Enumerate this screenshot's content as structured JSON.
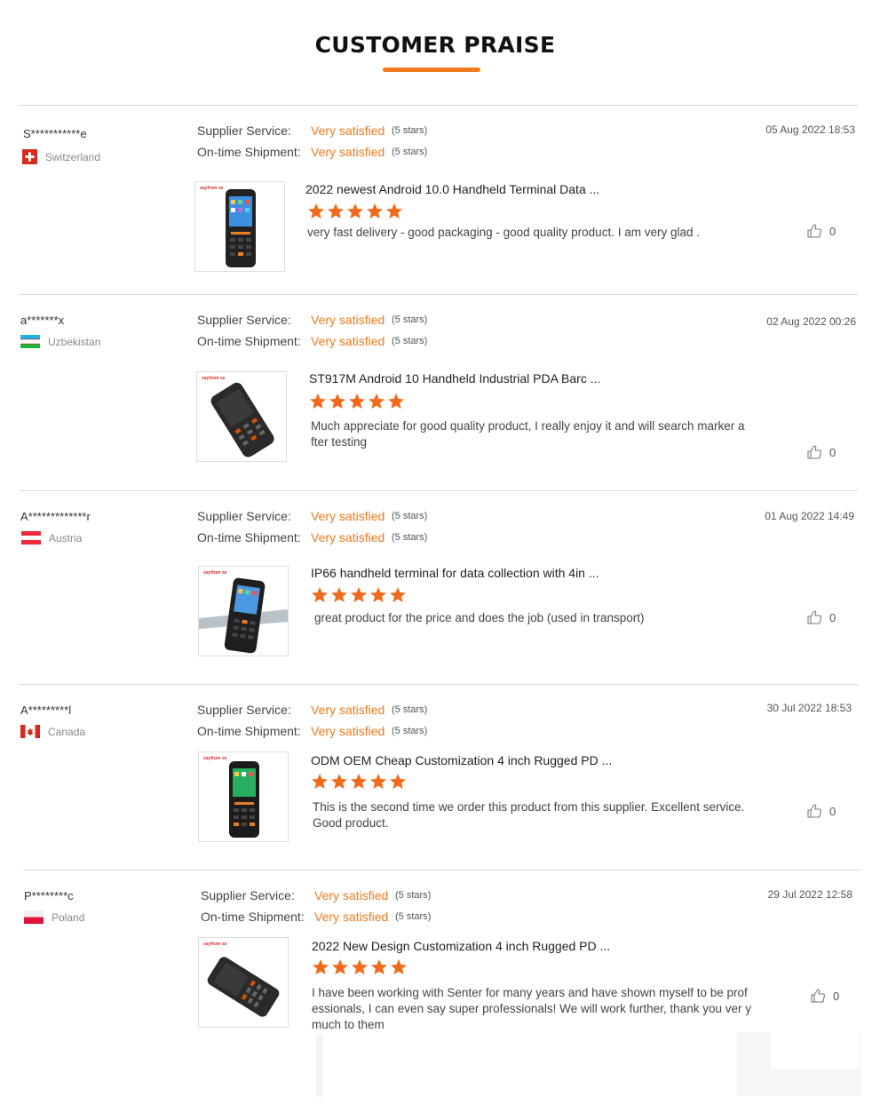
{
  "page": {
    "title": "CUSTOMER PRAISE",
    "accent": "#f07a1e"
  },
  "labels": {
    "supplier": "Supplier Service:",
    "shipment": "On-time Shipment:",
    "satisfied": "Very satisfied",
    "stars_note": "(5 stars)"
  },
  "reviews": [
    {
      "name": "S***********e",
      "country": "Switzerland",
      "date": "05 Aug 2022 18:53",
      "product": "2022 newest Android 10.0 Handheld Terminal Data ...",
      "comment": "very fast delivery - good packaging - good quality product. I am very glad .",
      "likes": "0",
      "rating": 5,
      "brand": "seyfrom se"
    },
    {
      "name": "a*******x",
      "country": "Uzbekistan",
      "date": "02 Aug 2022 00:26",
      "product": "ST917M Android 10 Handheld Industrial PDA Barc  ...",
      "comment": "Much appreciate for good quality product, I really enjoy it and will search marker a fter testing",
      "likes": "0",
      "rating": 5,
      "brand": "seyfrom se"
    },
    {
      "name": "A*************r",
      "country": "Austria",
      "date": "01 Aug 2022 14:49",
      "product": "IP66 handheld terminal for data collection with 4in ...",
      "comment": "great product for the price and does the job (used in transport)",
      "likes": "0",
      "rating": 5,
      "brand": "seyfrom se"
    },
    {
      "name": "A*********l",
      "country": "Canada",
      "date": "30 Jul 2022 18:53",
      "product": "ODM OEM Cheap Customization 4 inch Rugged PD ...",
      "comment": "This is the second time we order this product from this supplier. Excellent service. Good product.",
      "likes": "0",
      "rating": 5,
      "brand": "seyfrom se"
    },
    {
      "name": "P********c",
      "country": "Poland",
      "date": "29 Jul 2022 12:58",
      "product": "2022 New Design Customization 4 inch Rugged PD ...",
      "comment": "I have been working with Senter for many years and have shown myself to be prof essionals, I can even say super professionals!  We will work further, thank you ver y much to them",
      "likes": "0",
      "rating": 5,
      "brand": "seyfrom se"
    }
  ]
}
